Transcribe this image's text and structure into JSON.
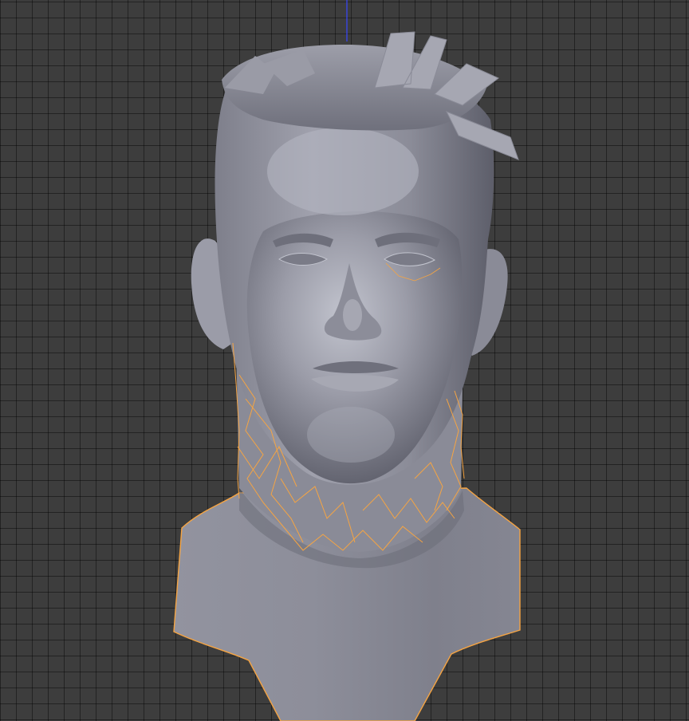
{
  "viewport": {
    "background_color": "#3d3d3d",
    "grid_line_color": "#2a2a2a",
    "z_axis_color": "#3a46ff"
  },
  "model": {
    "object_name": "head-bust",
    "shading": "solid",
    "base_color": "#8f909c",
    "shadow_color": "#5f606c",
    "highlight_color": "#c3c5cf",
    "selection_outline_color": "#f5a443",
    "selected": true
  }
}
